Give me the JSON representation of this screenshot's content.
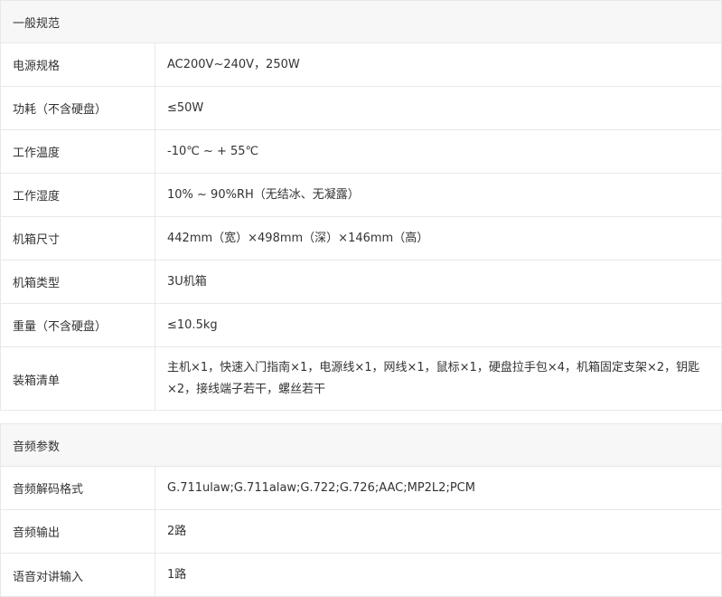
{
  "general": {
    "title": "一般规范",
    "rows": [
      {
        "label": "电源规格",
        "value": "AC200V~240V，250W"
      },
      {
        "label": "功耗（不含硬盘）",
        "value": "≤50W"
      },
      {
        "label": "工作温度",
        "value": "-10℃ ~ + 55℃"
      },
      {
        "label": "工作湿度",
        "value": "10% ~ 90%RH（无结冰、无凝露）"
      },
      {
        "label": "机箱尺寸",
        "value": "442mm（宽）×498mm（深）×146mm（高）"
      },
      {
        "label": "机箱类型",
        "value": "3U机箱"
      },
      {
        "label": "重量（不含硬盘）",
        "value": "≤10.5kg"
      },
      {
        "label": "装箱清单",
        "value": "主机×1，快速入门指南×1，电源线×1，网线×1，鼠标×1，硬盘拉手包×4，机箱固定支架×2，钥匙×2，接线端子若干，螺丝若干"
      }
    ]
  },
  "audio": {
    "title": "音频参数",
    "rows": [
      {
        "label": "音频解码格式",
        "value": "G.711ulaw;G.711alaw;G.722;G.726;AAC;MP2L2;PCM"
      },
      {
        "label": "音频输出",
        "value": "2路"
      },
      {
        "label": "语音对讲输入",
        "value": "1路"
      }
    ]
  }
}
